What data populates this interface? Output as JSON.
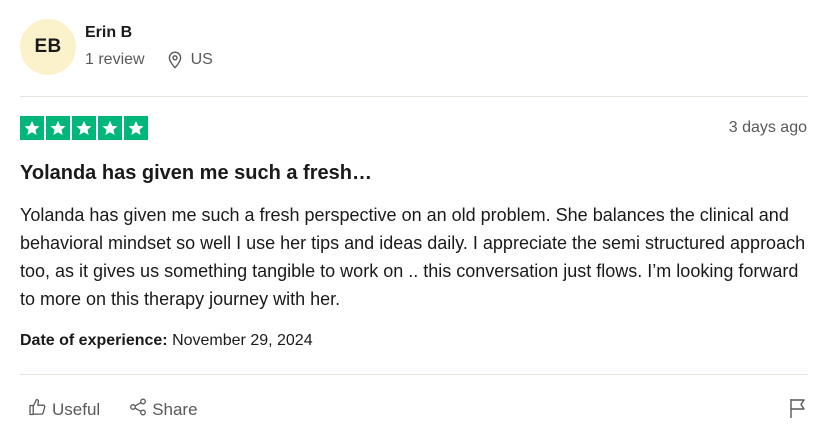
{
  "reviewer": {
    "initials": "EB",
    "name": "Erin B",
    "review_count": "1 review",
    "country": "US"
  },
  "review": {
    "rating": 5,
    "posted": "3 days ago",
    "title": "Yolanda has given me such a fresh…",
    "body": "Yolanda has given me such a fresh perspective on an old problem. She balances the clinical and behavioral mindset so well I use her tips and ideas daily. I appreciate the semi structured approach too, as it gives us something tangible to work on .. this conversation just flows. I’m looking forward to more on this therapy journey with her.",
    "experience_label": "Date of experience:",
    "experience_date": "November 29, 2024"
  },
  "actions": {
    "useful_label": "Useful",
    "share_label": "Share"
  },
  "icons": {
    "location": "location-pin-icon",
    "useful": "thumbs-up-icon",
    "share": "share-icon",
    "report": "flag-icon"
  },
  "colors": {
    "star_green": "#00b67a",
    "avatar_bg": "#fbf2cc",
    "muted_text": "#595959"
  }
}
